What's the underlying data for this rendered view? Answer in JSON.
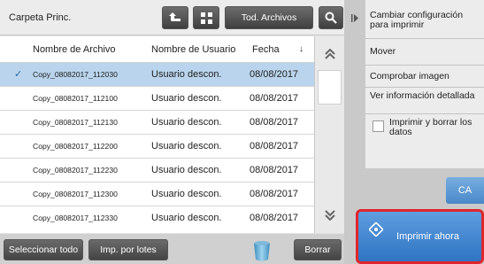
{
  "header": {
    "folder": "Carpeta Princ.",
    "filter_button": "Tod. Archivos"
  },
  "icons": {
    "up": "up-folder-icon",
    "grid": "grid-view-icon",
    "search": "search-icon",
    "trash": "trash-icon",
    "print": "print-diamond-icon"
  },
  "table": {
    "columns": [
      "Nombre de Archivo",
      "Nombre de Usuario",
      "Fecha"
    ],
    "sort_indicator": "↓",
    "rows": [
      {
        "file": "Copy_08082017_112030",
        "user": "Usuario descon.",
        "date": "08/08/2017",
        "selected": true
      },
      {
        "file": "Copy_08082017_112100",
        "user": "Usuario descon.",
        "date": "08/08/2017",
        "selected": false
      },
      {
        "file": "Copy_08082017_112130",
        "user": "Usuario descon.",
        "date": "08/08/2017",
        "selected": false
      },
      {
        "file": "Copy_08082017_112200",
        "user": "Usuario descon.",
        "date": "08/08/2017",
        "selected": false
      },
      {
        "file": "Copy_08082017_112230",
        "user": "Usuario descon.",
        "date": "08/08/2017",
        "selected": false
      },
      {
        "file": "Copy_08082017_112300",
        "user": "Usuario descon.",
        "date": "08/08/2017",
        "selected": false
      },
      {
        "file": "Copy_08082017_112330",
        "user": "Usuario descon.",
        "date": "08/08/2017",
        "selected": false
      }
    ]
  },
  "footer": {
    "select_all": "Seleccionar todo",
    "batch_print": "Imp. por lotes",
    "delete": "Borrar"
  },
  "side_menu": {
    "items": [
      "Cambiar configuración para imprimir",
      "Mover",
      "Comprobar imagen",
      "Ver información detallada"
    ],
    "checkbox_label": "Imprimir y borrar los datos",
    "checkbox_checked": false
  },
  "actions": {
    "ca": "CA",
    "print_now": "Imprimir ahora"
  },
  "colors": {
    "selected_row": "#b9d4ec",
    "print_button": "#3d85cf",
    "print_highlight": "#e0262d"
  }
}
